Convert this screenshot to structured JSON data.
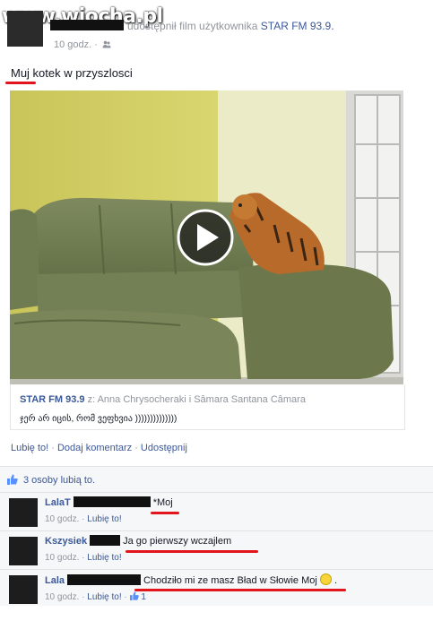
{
  "watermark": "www.wiocha.pl",
  "post": {
    "header_action": "udostępnił film użytkownika",
    "shared_page": "STAR FM 93.9.",
    "time": "10 godz. ·",
    "text": "Muj kotek w przyszlosci"
  },
  "shared": {
    "page": "STAR FM 93.9",
    "attribution": "z: Anna Chrysocheraki i Sâmara Santana Câmara",
    "description": "ჯერ არ იცის, რომ ვეფხვია ))))))))))))))"
  },
  "actions": {
    "like": "Lubię to!",
    "sep1": " · ",
    "comment": "Dodaj komentarz",
    "sep2": " · ",
    "share": "Udostępnij"
  },
  "likes": {
    "text": "3 osoby lubią to."
  },
  "comments": [
    {
      "name": "LalaT",
      "text": "*Moj",
      "time": "10 godz.",
      "like": "Lubię to!"
    },
    {
      "name": "Kszysiek",
      "text": "Ja go pierwszy wczajlem",
      "time": "10 godz.",
      "like": "Lubię to!"
    },
    {
      "name": "Lala",
      "text": "Chodziło mi ze masz Bład w Słowie Moj",
      "suffix": ".",
      "time": "10 godz.",
      "like": "Lubię to!",
      "like_count": "1"
    }
  ],
  "colors": {
    "link": "#3b5998",
    "annotation": "#e2141c",
    "meta": "#90949c"
  },
  "icons": {
    "audience": "friends-icon",
    "play": "play-icon",
    "thumb": "thumbs-up-icon",
    "emoji": "smile-emoji-icon"
  }
}
